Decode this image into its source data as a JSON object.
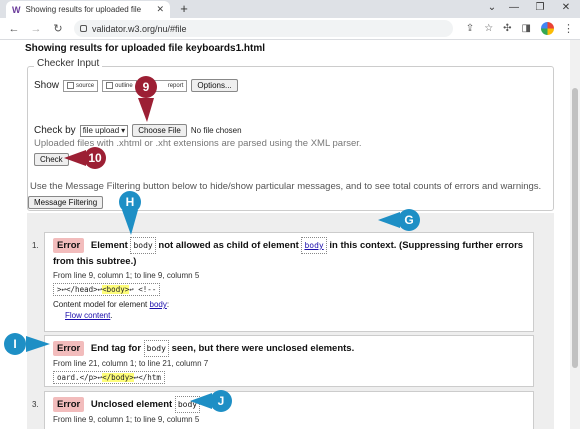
{
  "browser": {
    "tab_title": "Showing results for uploaded file",
    "url": "validator.w3.org/nu/#file",
    "new_tab": "+",
    "controls": {
      "minimize": "⌄",
      "restore": "—",
      "maximize": "❐",
      "close": "✕"
    }
  },
  "page": {
    "title": "Showing results for uploaded file keyboards1.html",
    "checker": {
      "legend": "Checker Input",
      "show_label": "Show",
      "options": [
        {
          "label": "source"
        },
        {
          "label": "outline"
        },
        {
          "label": "report"
        }
      ],
      "options_button": "Options...",
      "check_by_label": "Check by",
      "check_by_value": "file upload",
      "choose_file_button": "Choose File",
      "no_file_text": "No file chosen",
      "parse_note": "Uploaded files with .xhtml or .xht extensions are parsed using the XML parser.",
      "check_button": "Check"
    },
    "filter_note": "Use the Message Filtering button below to hide/show particular messages, and to see total counts of errors and warnings.",
    "filter_button": "Message Filtering",
    "messages": [
      {
        "num": "1.",
        "badge": "Error",
        "pre": "Element",
        "code1": "body",
        "mid": "not allowed as child of element",
        "code2": "body",
        "post": "in this context. (Suppressing further errors from this subtree.)",
        "location": "From line 9, column 1; to line 9, column 5",
        "extract_pre": ">↩</head>↩",
        "extract_hl": "<body>",
        "extract_post": "↩        <!--",
        "model_text": "Content model for element",
        "model_link": "body",
        "flow_link": "Flow content"
      },
      {
        "badge": "Error",
        "pre": "End tag for",
        "code1": "body",
        "post": "seen, but there were unclosed elements.",
        "location": "From line 21, column 1; to line 21, column 7",
        "extract_pre": "oard.</p>↩",
        "extract_hl": "</body>",
        "extract_post": "↩</htm"
      },
      {
        "num": "3.",
        "badge": "Error",
        "pre": "Unclosed element",
        "code1": "body",
        "location": "From line 9, column 1; to line 9, column 5"
      }
    ]
  },
  "callouts": {
    "nine": "9",
    "ten": "10",
    "g": "G",
    "h": "H",
    "i": "I",
    "j": "J"
  },
  "colors": {
    "callout_red": "#9c1f34",
    "callout_blue": "#1e8fc5",
    "error_badge": "#f2bcbc",
    "highlight": "#fffe7a"
  }
}
